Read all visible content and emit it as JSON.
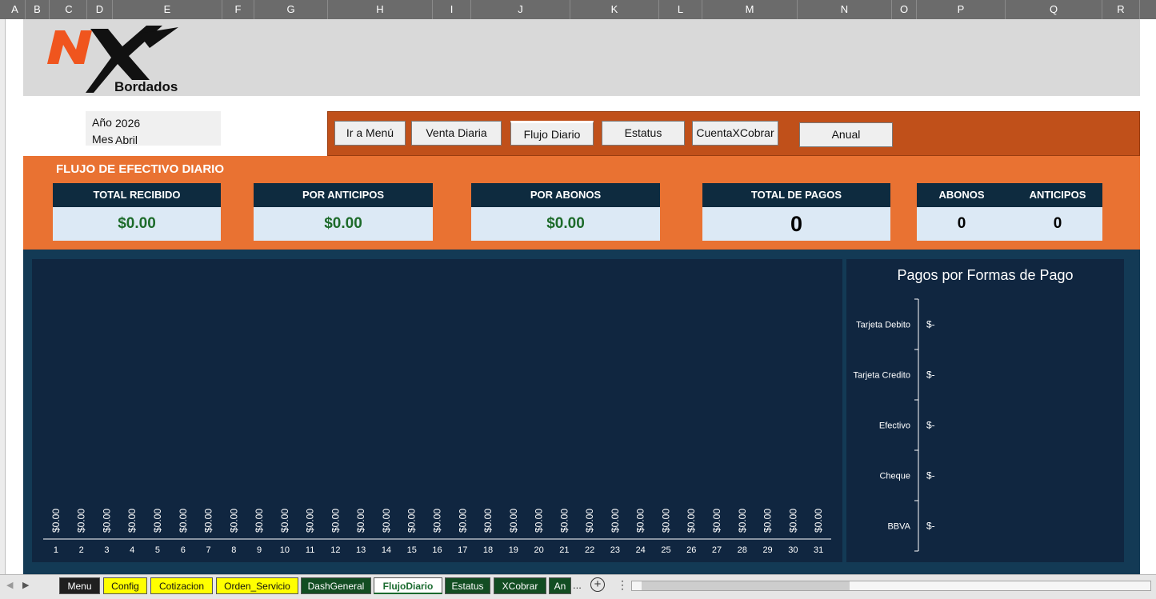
{
  "columns": [
    "A",
    "B",
    "C",
    "D",
    "E",
    "F",
    "G",
    "H",
    "I",
    "J",
    "K",
    "L",
    "M",
    "N",
    "O",
    "P",
    "Q",
    "R"
  ],
  "logo": {
    "text": "Bordados",
    "brand": "NX",
    "colors": {
      "accent": "#f0551e",
      "dark": "#111111"
    }
  },
  "period": {
    "year_label": "Año",
    "year": "2026",
    "month_label": "Mes",
    "month": "Abril"
  },
  "nav": {
    "menu": "Ir a Menú",
    "venta": "Venta Diaria",
    "flujo": "Flujo Diario",
    "estatus": "Estatus",
    "cxc": "CuentaXCobrar",
    "anual": "Anual"
  },
  "kpi": {
    "title": "FLUJO DE EFECTIVO DIARIO",
    "total_recibido": {
      "label": "TOTAL RECIBIDO",
      "value": "$0.00"
    },
    "por_anticipos": {
      "label": "POR ANTICIPOS",
      "value": "$0.00"
    },
    "por_abonos": {
      "label": "POR ABONOS",
      "value": "$0.00"
    },
    "total_pagos": {
      "label": "TOTAL DE PAGOS",
      "value": "0"
    },
    "abonos": {
      "label": "ABONOS",
      "value": "0"
    },
    "anticipos": {
      "label": "ANTICIPOS",
      "value": "0"
    }
  },
  "chart_data": [
    {
      "type": "bar",
      "categories": [
        "1",
        "2",
        "3",
        "4",
        "5",
        "6",
        "7",
        "8",
        "9",
        "10",
        "11",
        "12",
        "13",
        "14",
        "15",
        "16",
        "17",
        "18",
        "19",
        "20",
        "21",
        "22",
        "23",
        "24",
        "25",
        "26",
        "27",
        "28",
        "29",
        "30",
        "31"
      ],
      "values": [
        0,
        0,
        0,
        0,
        0,
        0,
        0,
        0,
        0,
        0,
        0,
        0,
        0,
        0,
        0,
        0,
        0,
        0,
        0,
        0,
        0,
        0,
        0,
        0,
        0,
        0,
        0,
        0,
        0,
        0,
        0
      ],
      "data_label": "$0.00",
      "title": "",
      "xlabel": "",
      "ylabel": ""
    },
    {
      "type": "bar",
      "orientation": "horizontal",
      "title": "Pagos por Formas de Pago",
      "categories": [
        "Tarjeta Debito",
        "Tarjeta Credito",
        "Efectivo",
        "Cheque",
        "BBVA"
      ],
      "values": [
        0,
        0,
        0,
        0,
        0
      ],
      "data_label": "$-"
    }
  ],
  "tabs": [
    "Menu",
    "Config",
    "Cotizacion",
    "Orden_Servicio",
    "DashGeneral",
    "FlujoDiario",
    "Estatus",
    "XCobrar",
    "An"
  ],
  "tab_more": "...",
  "colors": {
    "orange": "#e97232",
    "navy": "#0e2b3f",
    "nav_bar": "#c0501a",
    "money_green": "#1d6b2a"
  }
}
